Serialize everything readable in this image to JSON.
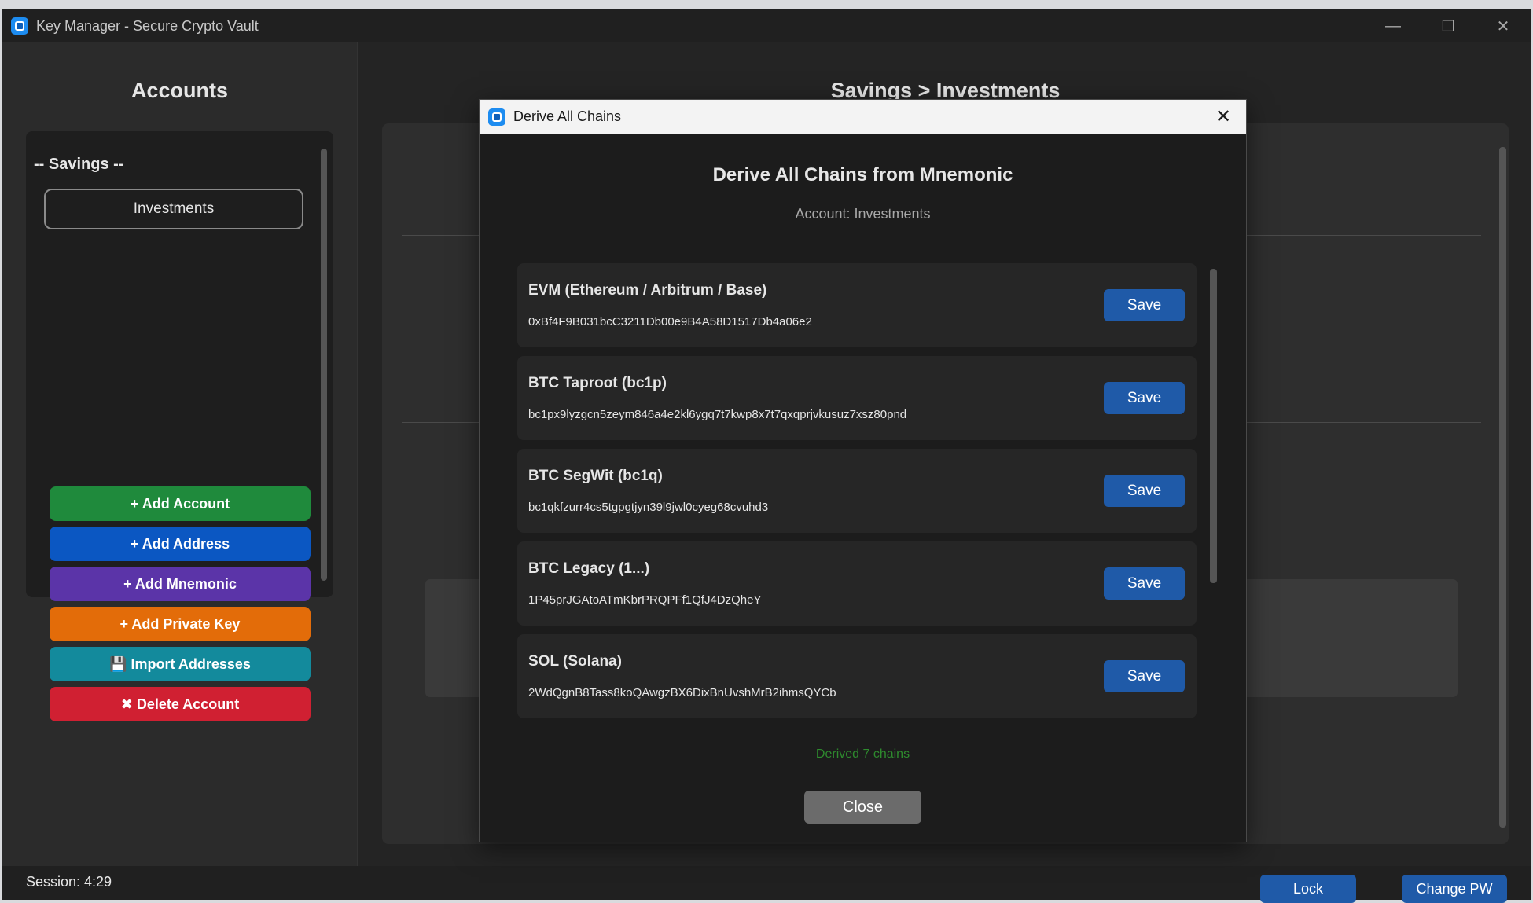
{
  "window": {
    "title": "Key Manager - Secure Crypto Vault",
    "minimize_glyph": "—",
    "maximize_glyph": "☐",
    "close_glyph": "✕"
  },
  "sidebar": {
    "title": "Accounts",
    "group_label": "-- Savings --",
    "accounts": [
      "Investments"
    ],
    "buttons": [
      {
        "label": "+ Add Account",
        "color": "#1f8a3c"
      },
      {
        "label": "+ Add Address",
        "color": "#0b57c2"
      },
      {
        "label": "+ Add Mnemonic",
        "color": "#5b34a8"
      },
      {
        "label": "+ Add Private Key",
        "color": "#e36c09"
      },
      {
        "label": "💾 Import Addresses",
        "color": "#138a9c"
      },
      {
        "label": "✖ Delete Account",
        "color": "#d02032"
      }
    ]
  },
  "main": {
    "breadcrumb": "Savings > Investments"
  },
  "statusbar": {
    "session": "Session: 4:29",
    "lock_label": "Lock",
    "change_pw_label": "Change PW"
  },
  "dialog": {
    "title": "Derive All Chains",
    "close_glyph": "✕",
    "heading": "Derive All Chains from Mnemonic",
    "subheading": "Account: Investments",
    "chains": [
      {
        "name": "EVM (Ethereum / Arbitrum / Base)",
        "address": "0xBf4F9B031bcC3211Db00e9B4A58D1517Db4a06e2",
        "save_label": "Save"
      },
      {
        "name": "BTC Taproot (bc1p)",
        "address": "bc1px9lyzgcn5zeym846a4e2kl6ygq7t7kwp8x7t7qxqprjvkusuz7xsz80pnd",
        "save_label": "Save"
      },
      {
        "name": "BTC SegWit (bc1q)",
        "address": "bc1qkfzurr4cs5tgpgtjyn39l9jwl0cyeg68cvuhd3",
        "save_label": "Save"
      },
      {
        "name": "BTC Legacy (1...)",
        "address": "1P45prJGAtoATmKbrPRQPFf1QfJ4DzQheY",
        "save_label": "Save"
      },
      {
        "name": "SOL (Solana)",
        "address": "2WdQgnB8Tass8koQAwgzBX6DixBnUvshMrB2ihmsQYCb",
        "save_label": "Save"
      }
    ],
    "status": "Derived 7 chains",
    "close_label": "Close"
  }
}
